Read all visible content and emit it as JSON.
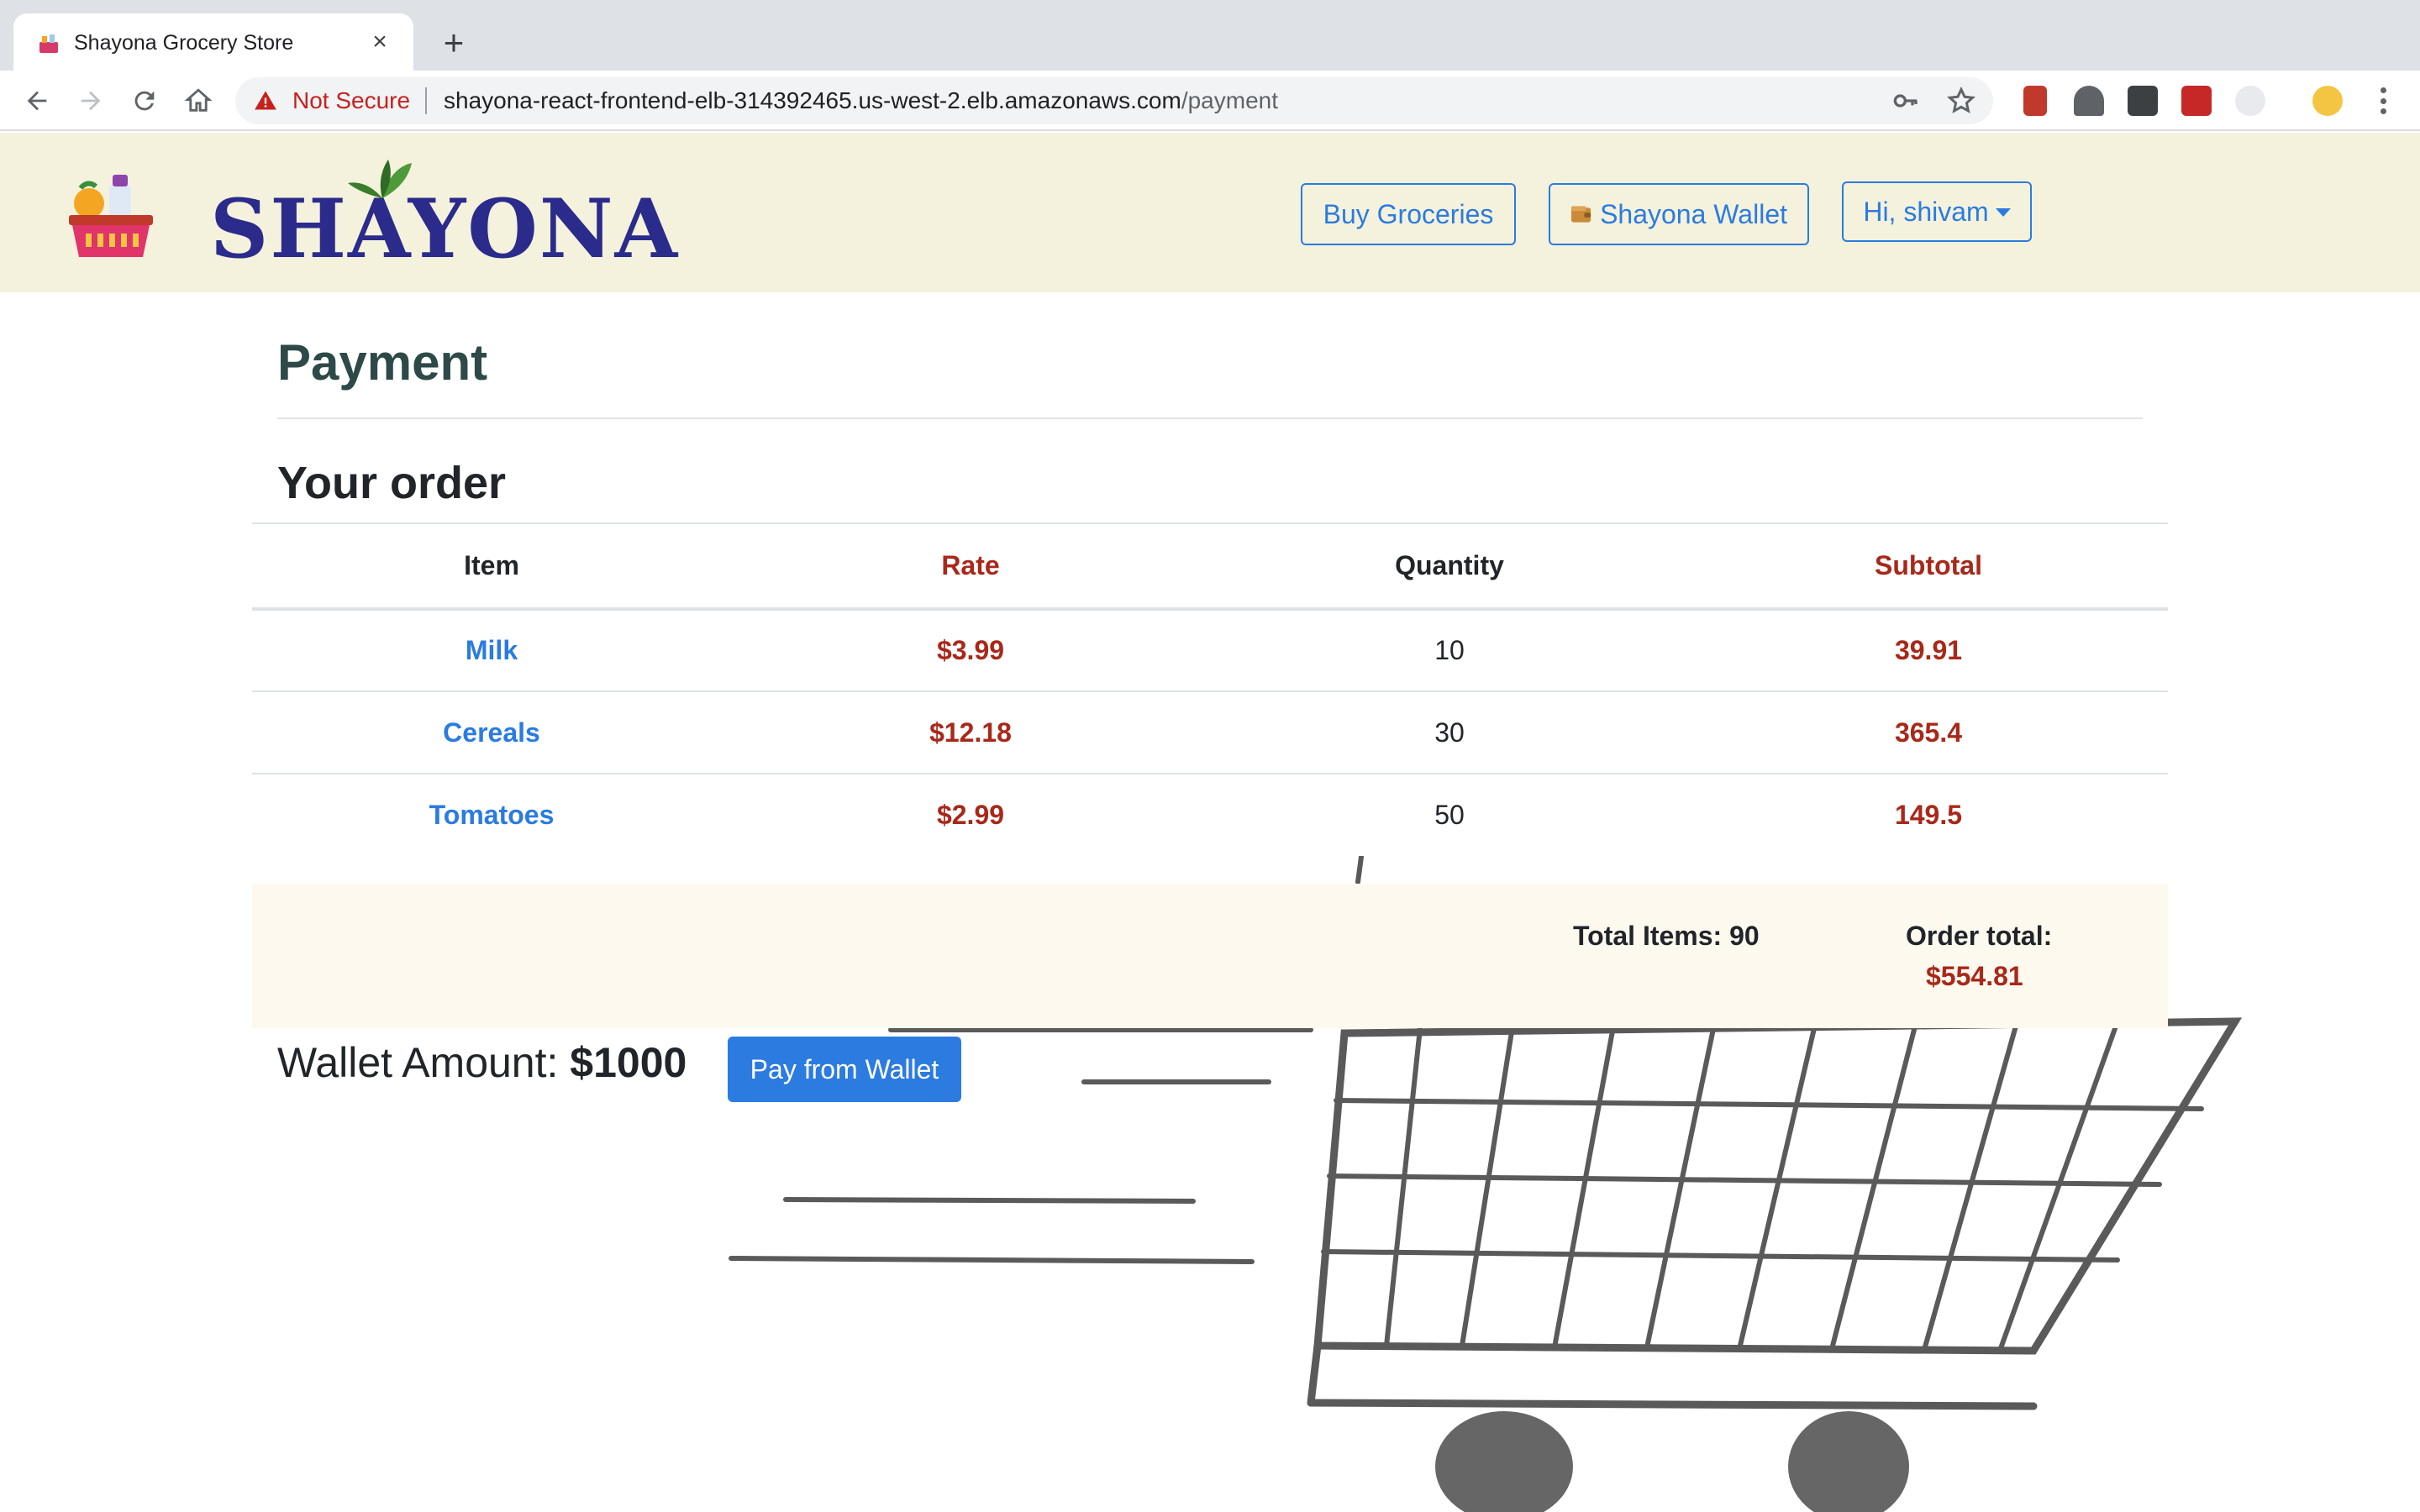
{
  "browser": {
    "tab_title": "Shayona Grocery Store",
    "security_label": "Not Secure",
    "url_host": "shayona-react-frontend-elb-314392465.us-west-2.elb.amazonaws.com",
    "url_path": "/payment"
  },
  "header": {
    "logo_text": "SHAYONA",
    "nav": {
      "buy_groceries": "Buy Groceries",
      "wallet": "Shayona Wallet",
      "user_menu": "Hi, shivam"
    }
  },
  "page": {
    "title": "Payment",
    "order_heading": "Your order"
  },
  "order": {
    "columns": [
      "Item",
      "Rate",
      "Quantity",
      "Subtotal"
    ],
    "rows": [
      {
        "item": "Milk",
        "rate": "$3.99",
        "quantity": "10",
        "subtotal": "39.91"
      },
      {
        "item": "Cereals",
        "rate": "$12.18",
        "quantity": "30",
        "subtotal": "365.4"
      },
      {
        "item": "Tomatoes",
        "rate": "$2.99",
        "quantity": "50",
        "subtotal": "149.5"
      }
    ],
    "total_items_label": "Total Items: 90",
    "order_total_label": "Order total:",
    "order_total_value": "$554.81"
  },
  "wallet": {
    "label": "Wallet Amount: ",
    "amount": "$1000",
    "pay_button": "Pay from Wallet"
  },
  "colors": {
    "accent_blue": "#2b7be0",
    "price_red": "#a8281a",
    "header_bg": "#f4f2dc",
    "summary_bg": "#fdf9ef"
  }
}
